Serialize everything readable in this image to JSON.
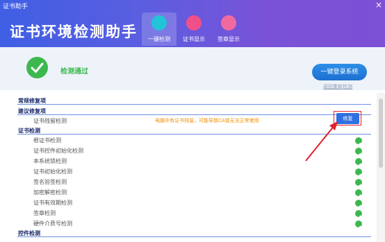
{
  "window": {
    "title": "证书助手",
    "close": "×"
  },
  "header": {
    "app_title": "证书环境检测助手"
  },
  "tabs": [
    {
      "label": "一键检测",
      "active": true
    },
    {
      "label": "证书显示"
    },
    {
      "label": "签章显示"
    }
  ],
  "status": {
    "text": "检测通过",
    "login_button": "一键登录系统",
    "back_link": "返回重新检测"
  },
  "sections": {
    "common": "常规修复项",
    "suggested": "建议修复项",
    "cert_check": "证书检测",
    "control_check": "控件检测"
  },
  "suggested_item": {
    "name": "证书残留检测",
    "warning": "电脑中有证书残留，可能导致CA锁无法正常使用",
    "fix_button": "修复"
  },
  "cert_items": [
    "根证书检测",
    "证书控件初始化检测",
    "本系统锁检测",
    "证书初始化检测",
    "签名验签检测",
    "加密解密检测",
    "证书有效期检测",
    "签章检测",
    "硬件介质号检测"
  ],
  "colors": {
    "ok": "#3cb84f",
    "warning": "#f08f00",
    "accent": "#2f6fe0",
    "highlight": "#e0202a"
  }
}
